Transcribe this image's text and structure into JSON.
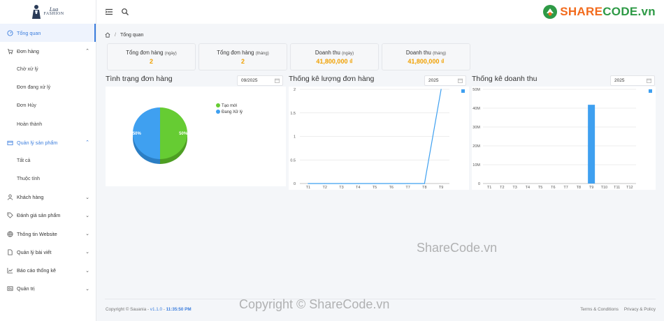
{
  "brand": {
    "logo_line1": "Lua",
    "logo_line2": "FASHION"
  },
  "watermark_logo": {
    "part1": "SHARE",
    "part2": "CODE.vn"
  },
  "sidebar": {
    "items": [
      {
        "label": "Tổng quan",
        "icon": "gauge-icon"
      },
      {
        "label": "Đơn hàng",
        "icon": "cart-icon"
      },
      {
        "label": "Chờ xử lý"
      },
      {
        "label": "Đơn đang xử lý"
      },
      {
        "label": "Đơn Hủy"
      },
      {
        "label": "Hoàn thành"
      },
      {
        "label": "Quản lý sản phẩm",
        "icon": "box-icon"
      },
      {
        "label": "Tất cả"
      },
      {
        "label": "Thuộc tính"
      },
      {
        "label": "Khách hàng",
        "icon": "user-icon"
      },
      {
        "label": "Đánh giá sản phẩm",
        "icon": "tag-icon"
      },
      {
        "label": "Thông tin Website",
        "icon": "globe-icon"
      },
      {
        "label": "Quản lý bài viết",
        "icon": "file-icon"
      },
      {
        "label": "Báo cáo thống kê",
        "icon": "chart-icon"
      },
      {
        "label": "Quản trị",
        "icon": "admin-icon"
      }
    ]
  },
  "breadcrumb": {
    "home_icon": "home-icon",
    "separator": "/",
    "current": "Tổng quan"
  },
  "stats": [
    {
      "label": "Tổng đơn hàng",
      "period": "(ngày)",
      "value": "2"
    },
    {
      "label": "Tổng đơn hàng",
      "period": "(tháng)",
      "value": "2"
    },
    {
      "label": "Doanh thu",
      "period": "(ngày)",
      "value": "41,800,000 ₫"
    },
    {
      "label": "Doanh thu",
      "period": "(tháng)",
      "value": "41,800,000 ₫"
    }
  ],
  "panels": {
    "status": {
      "title": "Tình trạng đơn hàng",
      "filter": "09/2025"
    },
    "orders": {
      "title": "Thống kê lượng đơn hàng",
      "filter": "2025"
    },
    "revenue": {
      "title": "Thống kê doanh thu",
      "filter": "2025"
    }
  },
  "colors": {
    "accent": "#3b7ddd",
    "green": "#66cc33",
    "blue": "#3fa0f0",
    "value": "#f0a000"
  },
  "chart_data": [
    {
      "type": "pie",
      "categories": [
        "Tạo mới",
        "Đang Xử lý"
      ],
      "values": [
        50,
        50
      ],
      "labels": [
        "50%",
        "50%"
      ],
      "legend": "top-right",
      "colors": [
        "#66cc33",
        "#3fa0f0"
      ]
    },
    {
      "type": "line",
      "categories": [
        "T1",
        "T2",
        "T3",
        "T4",
        "T5",
        "T6",
        "T7",
        "T8",
        "T9"
      ],
      "values": [
        0,
        0,
        0,
        0,
        0,
        0,
        0,
        0,
        2
      ],
      "yticks": [
        "0",
        "0.5",
        "1",
        "1.5",
        "2"
      ],
      "ylim": [
        0,
        2
      ],
      "grid": true,
      "legend": "top-right",
      "color": "#3fa0f0"
    },
    {
      "type": "bar",
      "categories": [
        "T1",
        "T2",
        "T3",
        "T4",
        "T5",
        "T6",
        "T7",
        "T8",
        "T9",
        "T10",
        "T11",
        "T12"
      ],
      "values": [
        0,
        0,
        0,
        0,
        0,
        0,
        0,
        0,
        41800000,
        0,
        0,
        0
      ],
      "yticks": [
        "0",
        "10M",
        "20M",
        "30M",
        "40M",
        "50M"
      ],
      "ylim": [
        0,
        50000000
      ],
      "grid": true,
      "legend": "top-right",
      "color": "#3fa0f0"
    }
  ],
  "footer": {
    "copyright": "Copyright © Sauania - ",
    "version": "v1.1.0",
    "dash": " - ",
    "time": "11:35:50 PM",
    "links": [
      "Terms & Conditions",
      "Privacy & Policy"
    ]
  },
  "watermarks": {
    "middle": "ShareCode.vn",
    "bottom": "Copyright © ShareCode.vn"
  }
}
